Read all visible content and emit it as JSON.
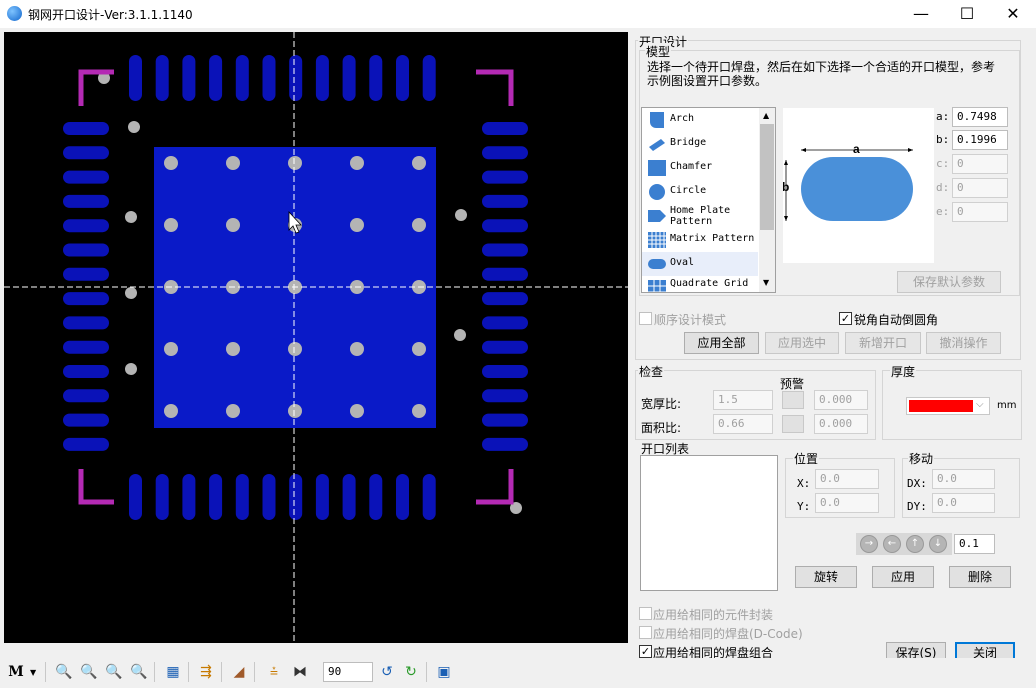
{
  "window": {
    "title": "钢网开口设计-Ver:3.1.1.1140",
    "minimize": "—",
    "maximize": "☐",
    "close": "✕"
  },
  "design_group": {
    "label": "开口设计",
    "model_label": "模型",
    "instruction": "选择一个待开口焊盘，然后在如下选择一个合适的开口模型，参考示例图设置开口参数。",
    "models": [
      {
        "name": "Arch",
        "icon": "arch-icon"
      },
      {
        "name": "Bridge",
        "icon": "bridge-icon"
      },
      {
        "name": "Chamfer",
        "icon": "chamfer-icon"
      },
      {
        "name": "Circle",
        "icon": "circle-icon"
      },
      {
        "name": "Home Plate Pattern",
        "icon": "home-plate-icon"
      },
      {
        "name": "Matrix Pattern",
        "icon": "matrix-icon"
      },
      {
        "name": "Oval",
        "icon": "oval-icon"
      },
      {
        "name": "Quadrate Grid",
        "icon": "quadrate-grid-icon"
      }
    ],
    "selected_model": "Oval",
    "preview": {
      "a_label": "a",
      "b_label": "b"
    },
    "params": [
      {
        "label": "a:",
        "value": "0.7498",
        "enabled": true
      },
      {
        "label": "b:",
        "value": "0.1996",
        "enabled": true
      },
      {
        "label": "c:",
        "value": "0",
        "enabled": false
      },
      {
        "label": "d:",
        "value": "0",
        "enabled": false
      },
      {
        "label": "e:",
        "value": "0",
        "enabled": false
      }
    ],
    "save_default_btn": "保存默认参数",
    "sequential_mode": {
      "label": "顺序设计模式",
      "checked": false
    },
    "auto_round": {
      "label": "锐角自动倒圆角",
      "checked": true
    },
    "apply_all_btn": "应用全部",
    "apply_selected_btn": "应用选中",
    "add_opening_btn": "新增开口",
    "undo_btn": "撤消操作"
  },
  "check_group": {
    "label": "检查",
    "warning_label": "预警",
    "aspect_ratio": {
      "label": "宽厚比:",
      "value": "1.5",
      "warn_value": "0.000"
    },
    "area_ratio": {
      "label": "面积比:",
      "value": "0.66",
      "warn_value": "0.000"
    }
  },
  "thickness_group": {
    "label": "厚度",
    "unit": "mm",
    "color": "#ff0000"
  },
  "opening_list": {
    "label": "开口列表"
  },
  "position_group": {
    "label": "位置",
    "x_label": "X:",
    "x_value": "0.0",
    "y_label": "Y:",
    "y_value": "0.0"
  },
  "move_group": {
    "label": "移动",
    "dx_label": "DX:",
    "dx_value": "0.0",
    "dy_label": "DY:",
    "dy_value": "0.0",
    "step_value": "0.1"
  },
  "rotate_btn": "旋转",
  "apply_btn": "应用",
  "delete_btn": "删除",
  "apply_same_package": {
    "label": "应用给相同的元件封装",
    "checked": false
  },
  "apply_same_pad": {
    "label": "应用给相同的焊盘(D-Code)",
    "checked": false
  },
  "apply_same_pad_group": {
    "label": "应用给相同的焊盘组合",
    "checked": true
  },
  "save_btn": "保存(S)",
  "close_btn": "关闭",
  "toolbar": {
    "rotation_value": "90"
  },
  "colors": {
    "pad_blue": "#0a12b8",
    "center_pad": "#0a1ac8",
    "via_gray": "#b4b4b4",
    "corner_magenta": "#b42ab4",
    "oval_preview": "#4a90d9"
  }
}
